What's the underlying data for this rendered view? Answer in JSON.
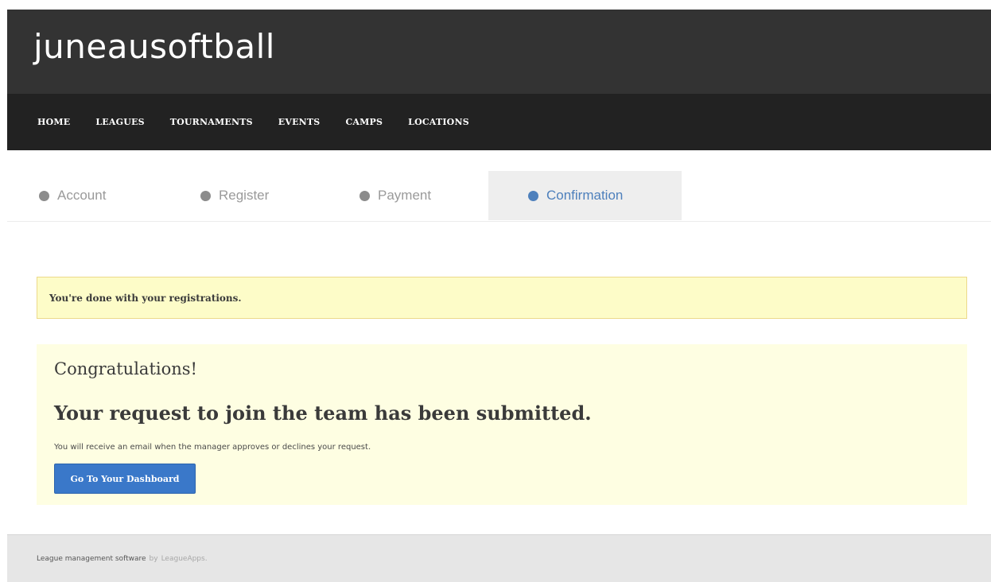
{
  "header": {
    "site_title": "juneausoftball"
  },
  "nav": {
    "items": [
      {
        "label": "HOME"
      },
      {
        "label": "LEAGUES"
      },
      {
        "label": "TOURNAMENTS"
      },
      {
        "label": "EVENTS"
      },
      {
        "label": "CAMPS"
      },
      {
        "label": "LOCATIONS"
      }
    ]
  },
  "steps": [
    {
      "label": "Account",
      "state": "complete"
    },
    {
      "label": "Register",
      "state": "complete"
    },
    {
      "label": "Payment",
      "state": "complete"
    },
    {
      "label": "Confirmation",
      "state": "active"
    }
  ],
  "alert": {
    "text": "You're done with your registrations."
  },
  "confirmation": {
    "heading": "Congratulations!",
    "title": "Your request to join the team has been submitted.",
    "message": "You will receive an email when the manager approves or declines your request.",
    "button_label": "Go To Your Dashboard"
  },
  "footer": {
    "text": "League management software",
    "by": "by",
    "link": "LeagueApps."
  },
  "colors": {
    "header_bg": "#333333",
    "nav_bg": "#222222",
    "accent_blue": "#4e80bc",
    "button_blue": "#3a78c9",
    "alert_bg": "#fdfcc8",
    "confirm_bg": "#fefee2"
  }
}
